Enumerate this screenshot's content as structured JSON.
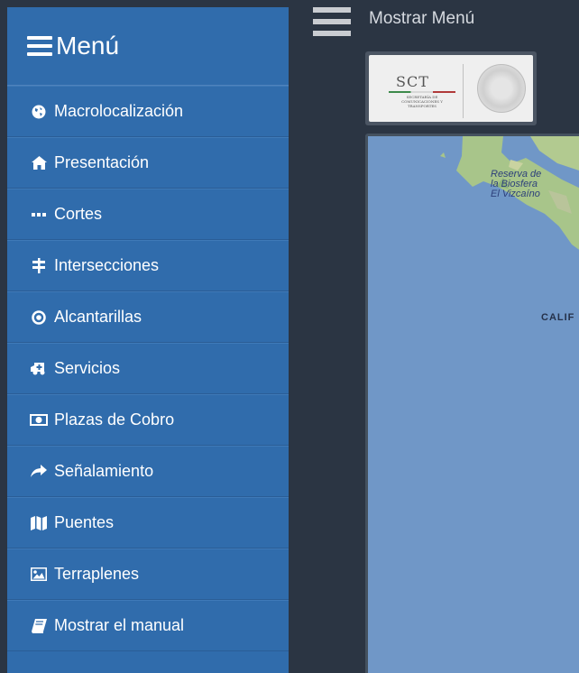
{
  "sidebar": {
    "title": "Menú",
    "items": [
      {
        "label": "Macrolocalización",
        "icon": "globe-icon"
      },
      {
        "label": "Presentación",
        "icon": "home-icon"
      },
      {
        "label": "Cortes",
        "icon": "ellipsis-icon"
      },
      {
        "label": "Intersecciones",
        "icon": "signpost-icon"
      },
      {
        "label": "Alcantarillas",
        "icon": "dot-circle-icon"
      },
      {
        "label": "Servicios",
        "icon": "ambulance-icon"
      },
      {
        "label": "Plazas de Cobro",
        "icon": "money-icon"
      },
      {
        "label": "Señalamiento",
        "icon": "share-arrow-icon"
      },
      {
        "label": "Puentes",
        "icon": "map-icon"
      },
      {
        "label": "Terraplenes",
        "icon": "image-icon"
      },
      {
        "label": "Mostrar el manual",
        "icon": "book-icon"
      }
    ]
  },
  "topbar": {
    "toggle_label": "Mostrar Menú"
  },
  "logo": {
    "acronym": "SCT",
    "subtitle": "SECRETARÍA DE COMUNICACIONES Y TRANSPORTES"
  },
  "map": {
    "reserve_label_line1": "Reserva de",
    "reserve_label_line2": "la Biosfera",
    "reserve_label_line3": "El Vizcaíno",
    "state_label": "CALIF"
  },
  "colors": {
    "sidebar_bg": "#306cac",
    "page_bg": "#2b3543",
    "sea": "#7097c7",
    "land": "#a8c58a"
  }
}
